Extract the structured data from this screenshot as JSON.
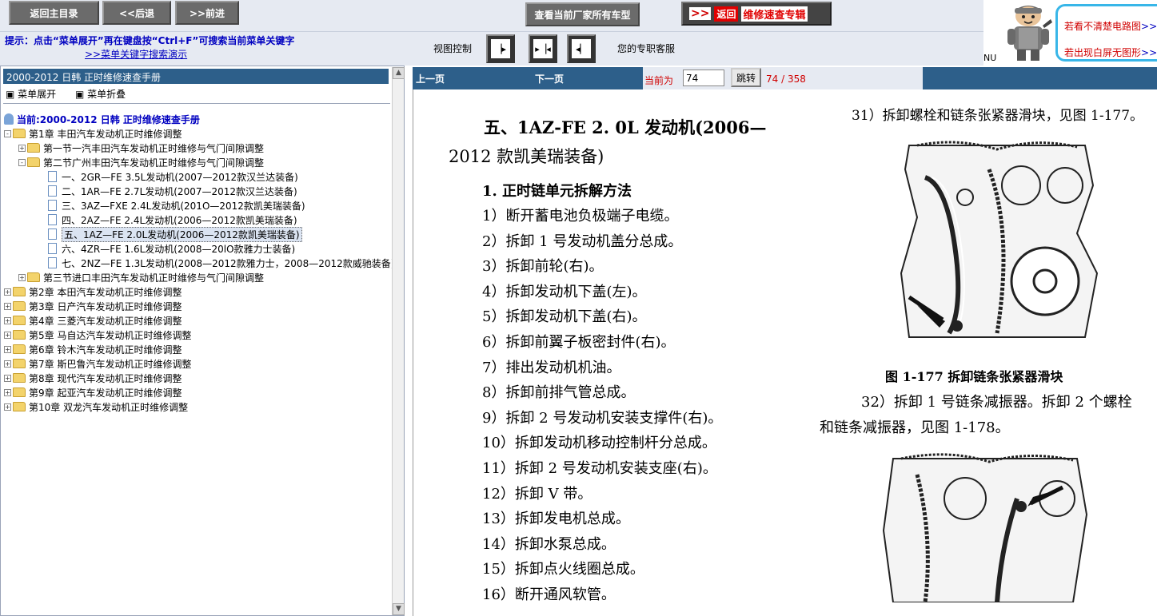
{
  "toolbar": {
    "home_label": "返回主目录",
    "back_label": "<<后退",
    "forward_label": ">>前进",
    "models_label": "查看当前厂家所有车型",
    "return_arrows": ">>",
    "return_label": "返回",
    "return_title": "维修速查专辑"
  },
  "hint": {
    "text": "提示：点击“菜单展开”再在键盘按“Ctrl+F”可搜索当前菜单关键字",
    "link": ">>菜单关键字搜索演示"
  },
  "view_control": {
    "label": "视图控制",
    "service_text": "您的专职客服",
    "nu_text": "NU"
  },
  "ad": {
    "line1_text": "若看不清楚电路图",
    "line1_link": ">>",
    "line2_text": "若出现白屏无图形",
    "line2_link": ">>"
  },
  "left_panel": {
    "header": "2000-2012 日韩 正时维修速查手册",
    "expand_label": "菜单展开",
    "collapse_label": "菜单折叠",
    "root": "当前:2000-2012 日韩 正时维修速查手册",
    "tree": [
      {
        "label": "第1章 丰田汽车发动机正时维修调整",
        "level": 0,
        "sign": "-",
        "icon": "folder"
      },
      {
        "label": "第一节一汽丰田汽车发动机正时维修与气门间隙调整",
        "level": 1,
        "sign": "+",
        "icon": "folder"
      },
      {
        "label": "第二节广州丰田汽车发动机正时维修与气门间隙调整",
        "level": 1,
        "sign": "-",
        "icon": "folder"
      },
      {
        "label": "一、2GR—FE 3.5L发动机(2007—2012款汉兰达装备)",
        "level": 2,
        "sign": "",
        "icon": "doc"
      },
      {
        "label": "二、1AR—FE 2.7L发动机(2007—2012款汉兰达装备)",
        "level": 2,
        "sign": "",
        "icon": "doc"
      },
      {
        "label": "三、3AZ—FXE 2.4L发动机(201O—2012款凯美瑞装备)",
        "level": 2,
        "sign": "",
        "icon": "doc"
      },
      {
        "label": "四、2AZ—FE 2.4L发动机(2006—2012款凯美瑞装备)",
        "level": 2,
        "sign": "",
        "icon": "doc"
      },
      {
        "label": "五、1AZ—FE 2.0L发动机(2006—2012款凯美瑞装备)",
        "level": 2,
        "sign": "",
        "icon": "doc",
        "selected": true
      },
      {
        "label": "六、4ZR—FE 1.6L发动机(2008—20lO款雅力士装备)",
        "level": 2,
        "sign": "",
        "icon": "doc"
      },
      {
        "label": "七、2NZ—FE 1.3L发动机(2008—2012款雅力士，2008—2012款威驰装备)",
        "level": 2,
        "sign": "",
        "icon": "doc"
      },
      {
        "label": "第三节进口丰田汽车发动机正时维修与气门间隙调整",
        "level": 1,
        "sign": "+",
        "icon": "folder"
      },
      {
        "label": "第2章 本田汽车发动机正时维修调整",
        "level": 0,
        "sign": "+",
        "icon": "folder"
      },
      {
        "label": "第3章 日产汽车发动机正时维修调整",
        "level": 0,
        "sign": "+",
        "icon": "folder"
      },
      {
        "label": "第4章 三菱汽车发动机正时维修调整",
        "level": 0,
        "sign": "+",
        "icon": "folder"
      },
      {
        "label": "第5章 马自达汽车发动机正时维修调整",
        "level": 0,
        "sign": "+",
        "icon": "folder"
      },
      {
        "label": "第6章 铃木汽车发动机正时维修调整",
        "level": 0,
        "sign": "+",
        "icon": "folder"
      },
      {
        "label": "第7章 斯巴鲁汽车发动机正时维修调整",
        "level": 0,
        "sign": "+",
        "icon": "folder"
      },
      {
        "label": "第8章 现代汽车发动机正时维修调整",
        "level": 0,
        "sign": "+",
        "icon": "folder"
      },
      {
        "label": "第9章 起亚汽车发动机正时维修调整",
        "level": 0,
        "sign": "+",
        "icon": "folder"
      },
      {
        "label": "第10章 双龙汽车发动机正时维修调整",
        "level": 0,
        "sign": "+",
        "icon": "folder"
      }
    ]
  },
  "pager": {
    "prev_label": "上一页",
    "next_label": "下一页",
    "current_label": "当前为",
    "current_value": "74",
    "jump_label": "跳转",
    "page_count": "74 / 358"
  },
  "document": {
    "title_line1": "五、1AZ-FE 2. 0L 发动机(2006—",
    "title_line2": "2012 款凯美瑞装备)",
    "subtitle": "1.  正时链单元拆解方法",
    "steps": [
      "1）断开蓄电池负极端子电缆。",
      "2）拆卸 1 号发动机盖分总成。",
      "3）拆卸前轮(右)。",
      "4）拆卸发动机下盖(左)。",
      "5）拆卸发动机下盖(右)。",
      "6）拆卸前翼子板密封件(右)。",
      "7）排出发动机机油。",
      "8）拆卸前排气管总成。",
      "9）拆卸 2 号发动机安装支撑件(右)。",
      "10）拆卸发动机移动控制杆分总成。",
      "11）拆卸 2 号发动机安装支座(右)。",
      "12）拆卸 V 带。",
      "13）拆卸发电机总成。",
      "14）拆卸水泵总成。",
      "15）拆卸点火线圈总成。",
      "16）断开通风软管。"
    ],
    "right_step31": "31）拆卸螺栓和链条张紧器滑块，见图 1-177。",
    "fig1_caption": "图 1-177    拆卸链条张紧器滑块",
    "right_step32a": "32）拆卸 1 号链条减振器。拆卸 2 个螺栓",
    "right_step32b": "和链条减振器，见图 1-178。"
  }
}
